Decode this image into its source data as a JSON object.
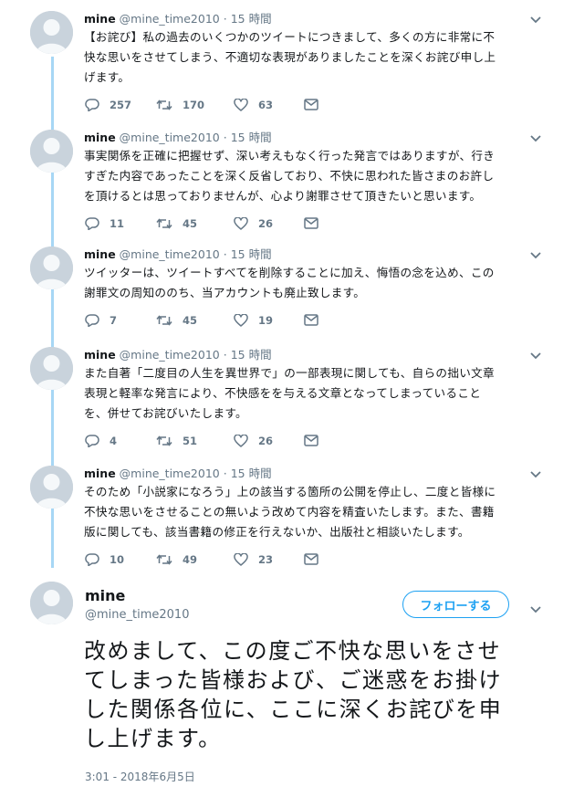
{
  "thread": [
    {
      "name": "mine",
      "handle": "@mine_time2010",
      "dot": "·",
      "time": "15 時間",
      "lines": [
        "【お詫び】私の過去のいくつかのツイートにつきまして、多くの方に非常に不",
        "快な思いをさせてしまう、不適切な表現がありましたことを深くお詫び申し上",
        "げます。"
      ],
      "replies": "257",
      "retweets": "170",
      "likes": "63"
    },
    {
      "name": "mine",
      "handle": "@mine_time2010",
      "dot": "·",
      "time": "15 時間",
      "lines": [
        "事実関係を正確に把握せず、深い考えもなく行った発言ではありますが、行き",
        "すぎた内容であったことを深く反省しており、不快に思われた皆さまのお許し",
        "を頂けるとは思っておりませんが、心より謝罪させて頂きたいと思います。"
      ],
      "replies": "11",
      "retweets": "45",
      "likes": "26"
    },
    {
      "name": "mine",
      "handle": "@mine_time2010",
      "dot": "·",
      "time": "15 時間",
      "lines": [
        "ツイッターは、ツイートすべてを削除することに加え、悔悟の念を込め、この",
        "謝罪文の周知ののち、当アカウントも廃止致します。"
      ],
      "replies": "7",
      "retweets": "45",
      "likes": "19"
    },
    {
      "name": "mine",
      "handle": "@mine_time2010",
      "dot": "·",
      "time": "15 時間",
      "lines": [
        "また自著「二度目の人生を異世界で」の一部表現に関しても、自らの拙い文章",
        "表現と軽率な発言により、不快感をを与える文章となってしまっていること",
        "を、併せてお詫びいたします。"
      ],
      "replies": "4",
      "retweets": "51",
      "likes": "26"
    },
    {
      "name": "mine",
      "handle": "@mine_time2010",
      "dot": "·",
      "time": "15 時間",
      "lines": [
        "そのため「小説家になろう」上の該当する箇所の公開を停止し、二度と皆様に",
        "不快な思いをさせることの無いよう改めて内容を精査いたします。また、書籍",
        "版に関しても、該当書籍の修正を行えないか、出版社と相談いたします。"
      ],
      "replies": "10",
      "retweets": "49",
      "likes": "23"
    }
  ],
  "main": {
    "name": "mine",
    "handle": "@mine_time2010",
    "follow_label": "フォローする",
    "lines": [
      "改めまして、この度ご不快な思いをさせ",
      "てしまった皆様および、ご迷惑をお掛け",
      "した関係各位に、ここに深くお詫びを申",
      "し上げます。"
    ],
    "timestamp": "3:01 - 2018年6月5日"
  },
  "icons": {
    "reply": "reply-icon",
    "retweet": "retweet-icon",
    "like": "heart-icon",
    "dm": "envelope-icon",
    "caret": "chevron-down-icon"
  },
  "colors": {
    "accent": "#1da1f2",
    "thread_line": "#a7d7f5",
    "secondary_text": "#657786"
  }
}
